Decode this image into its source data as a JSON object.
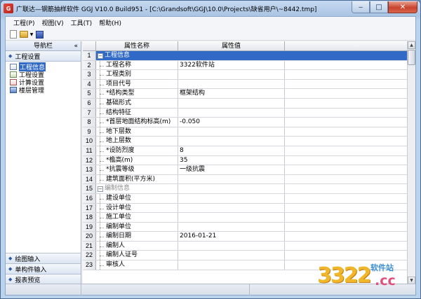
{
  "window": {
    "title": "广联达—钢筋抽样软件 GGJ V10.0 Build951 - [C:\\Grandsoft\\GGJ\\10.0\\Projects\\缺省用户\\~8442.tmp]",
    "minimize": "‒",
    "maximize": "□",
    "close": "✕"
  },
  "menu": [
    {
      "label": "工程(P)"
    },
    {
      "label": "视图(V)"
    },
    {
      "label": "工具(T)"
    },
    {
      "label": "帮助(H)"
    }
  ],
  "nav": {
    "title": "导航栏",
    "pin": "«",
    "section": "工程设置",
    "items": [
      {
        "label": "工程信息",
        "selected": true
      },
      {
        "label": "工程设置",
        "selected": false
      },
      {
        "label": "计算设置",
        "selected": false
      },
      {
        "label": "楼层管理",
        "selected": false
      }
    ],
    "bottom_groups": [
      {
        "label": "绘图输入"
      },
      {
        "label": "单构件输入"
      },
      {
        "label": "报表预览"
      }
    ]
  },
  "grid": {
    "col_name": "属性名称",
    "col_value": "属性值",
    "rows": [
      {
        "num": "1",
        "name": "工程信息",
        "value": "",
        "type": "group1"
      },
      {
        "num": "2",
        "name": "工程名称",
        "value": "3322软件站",
        "type": "child"
      },
      {
        "num": "3",
        "name": "工程类别",
        "value": "",
        "type": "child"
      },
      {
        "num": "4",
        "name": "项目代号",
        "value": "",
        "type": "child"
      },
      {
        "num": "5",
        "name": "*结构类型",
        "value": "框架结构",
        "type": "child"
      },
      {
        "num": "6",
        "name": "基础形式",
        "value": "",
        "type": "child"
      },
      {
        "num": "7",
        "name": "结构特征",
        "value": "",
        "type": "child"
      },
      {
        "num": "8",
        "name": "*首层地面结构标高(m)",
        "value": "-0.050",
        "type": "child"
      },
      {
        "num": "9",
        "name": "地下层数",
        "value": "",
        "type": "child"
      },
      {
        "num": "10",
        "name": "地上层数",
        "value": "",
        "type": "child"
      },
      {
        "num": "11",
        "name": "*设防烈度",
        "value": "8",
        "type": "child"
      },
      {
        "num": "12",
        "name": "*檐高(m)",
        "value": "35",
        "type": "child"
      },
      {
        "num": "13",
        "name": "*抗震等级",
        "value": "一级抗震",
        "type": "child"
      },
      {
        "num": "14",
        "name": "建筑面积(平方米)",
        "value": "",
        "type": "child"
      },
      {
        "num": "15",
        "name": "编制信息",
        "value": "",
        "type": "group2"
      },
      {
        "num": "16",
        "name": "建设单位",
        "value": "",
        "type": "child"
      },
      {
        "num": "17",
        "name": "设计单位",
        "value": "",
        "type": "child"
      },
      {
        "num": "18",
        "name": "施工单位",
        "value": "",
        "type": "child"
      },
      {
        "num": "19",
        "name": "编制单位",
        "value": "",
        "type": "child"
      },
      {
        "num": "20",
        "name": "编制日期",
        "value": "2016-01-21",
        "type": "child"
      },
      {
        "num": "21",
        "name": "编制人",
        "value": "",
        "type": "child"
      },
      {
        "num": "22",
        "name": "编制人证号",
        "value": "",
        "type": "child"
      },
      {
        "num": "23",
        "name": "审核人",
        "value": "",
        "type": "child"
      }
    ]
  },
  "watermark": {
    "digits": "3322",
    "site": "软件站",
    "cc": ".cc"
  }
}
